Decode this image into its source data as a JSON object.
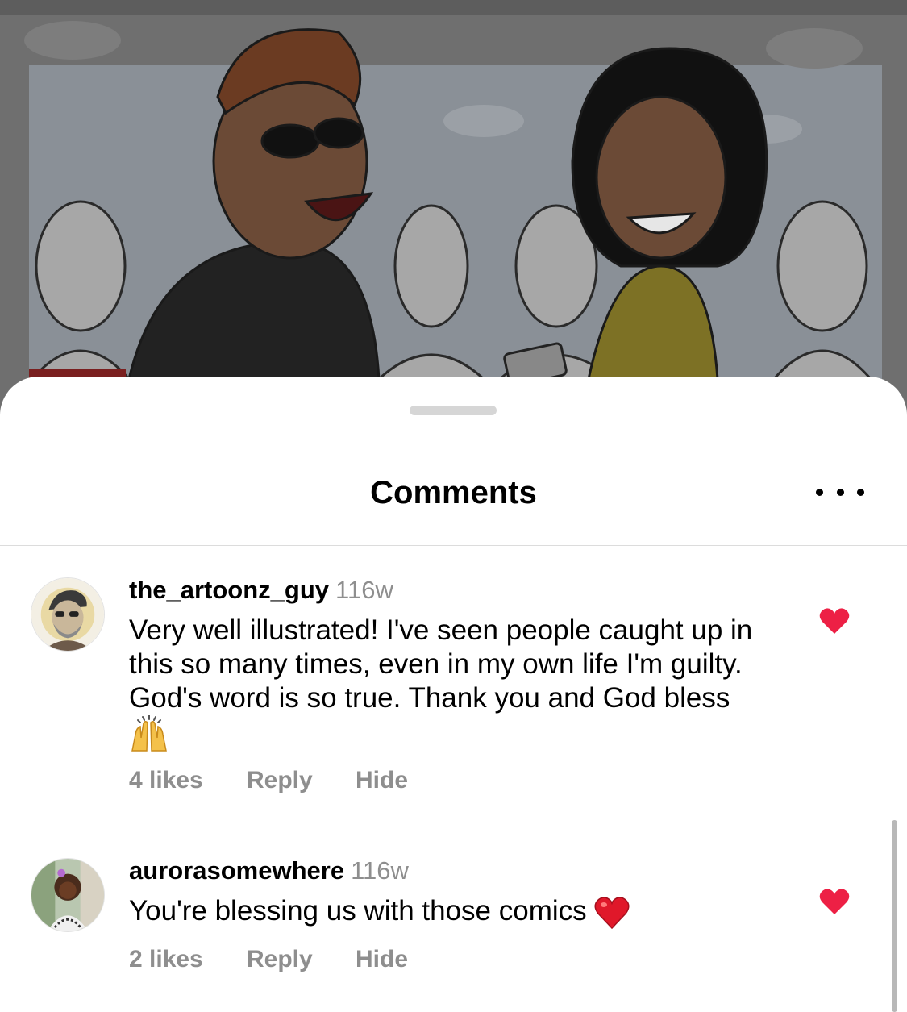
{
  "sheet": {
    "title": "Comments",
    "more_icon": "more-horizontal-icon"
  },
  "comments": [
    {
      "username": "the_artoonz_guy",
      "time": "116w",
      "text": "Very well illustrated! I've seen people caught up in this so many times, even in my own life I'm guilty.  God's word is so true. Thank you and God bless",
      "emoji": "raising-hands-emoji",
      "likes": "4 likes",
      "reply": "Reply",
      "hide": "Hide",
      "liked": true
    },
    {
      "username": "aurorasomewhere",
      "time": "116w",
      "text": "You're blessing us with those comics",
      "emoji": "red-heart-emoji",
      "likes": "2 likes",
      "reply": "Reply",
      "hide": "Hide",
      "liked": true
    }
  ],
  "colors": {
    "like_heart": "#ED2045",
    "secondary_text": "#8E8E8E",
    "dim_overlay": "#6F6F6F"
  }
}
